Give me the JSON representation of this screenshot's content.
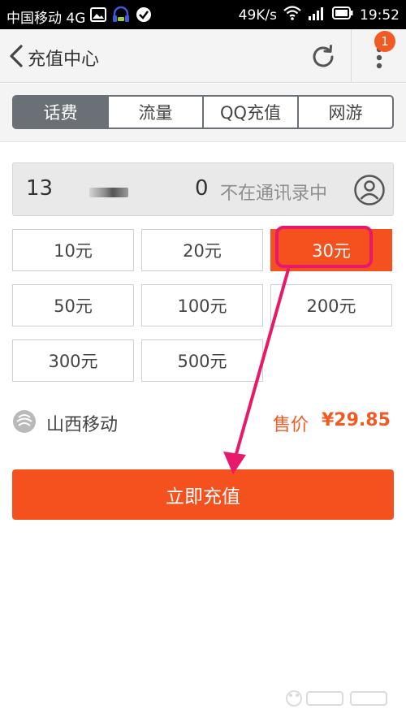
{
  "status_bar": {
    "carrier": "中国移动 4G",
    "speed": "49K/s",
    "time": "19:52"
  },
  "header": {
    "title": "充值中心",
    "badge_count": "1"
  },
  "tabs": [
    {
      "label": "话费",
      "active": true
    },
    {
      "label": "流量",
      "active": false
    },
    {
      "label": "QQ充值",
      "active": false
    },
    {
      "label": "网游",
      "active": false
    }
  ],
  "phone": {
    "prefix": "13",
    "suffix": "0",
    "contact_hint": "不在通讯录中"
  },
  "amounts": [
    {
      "label": "10元",
      "selected": false
    },
    {
      "label": "20元",
      "selected": false
    },
    {
      "label": "30元",
      "selected": true
    },
    {
      "label": "50元",
      "selected": false
    },
    {
      "label": "100元",
      "selected": false
    },
    {
      "label": "200元",
      "selected": false
    },
    {
      "label": "300元",
      "selected": false
    },
    {
      "label": "500元",
      "selected": false
    }
  ],
  "operator": {
    "name": "山西移动"
  },
  "price": {
    "label": "售价",
    "value": "¥29.85"
  },
  "recharge_button": "立即充值",
  "colors": {
    "accent": "#f4511e",
    "tab_active": "#6b7077",
    "highlight": "#e8186a"
  },
  "icons": [
    "back-icon",
    "refresh-icon",
    "more-icon",
    "contact-icon",
    "operator-icon",
    "wifi-icon",
    "signal-icon",
    "battery-icon"
  ]
}
